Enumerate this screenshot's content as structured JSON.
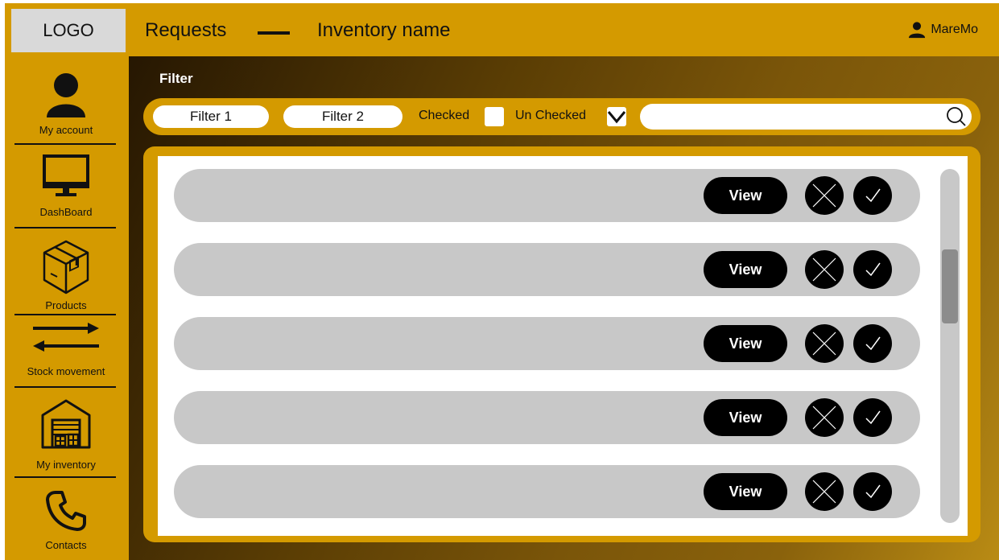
{
  "header": {
    "logo": "LOGO",
    "title": "Requests",
    "inventory_name": "Inventory name",
    "username": "MareMo"
  },
  "sidebar": {
    "items": [
      {
        "label": "My account",
        "icon": "user-icon"
      },
      {
        "label": "DashBoard",
        "icon": "monitor-icon"
      },
      {
        "label": "Products",
        "icon": "box-icon"
      },
      {
        "label": "Stock movement",
        "icon": "arrows-icon"
      },
      {
        "label": "My inventory",
        "icon": "warehouse-icon"
      },
      {
        "label": "Contacts",
        "icon": "phone-icon"
      }
    ]
  },
  "filter": {
    "title": "Filter",
    "filter1": "Filter 1",
    "filter2": "Filter 2",
    "checked_label": "Checked",
    "unchecked_label": "Un Checked",
    "checked_state": false,
    "unchecked_state": true,
    "search_placeholder": ""
  },
  "requests": {
    "rows": [
      {
        "view_label": "View"
      },
      {
        "view_label": "View"
      },
      {
        "view_label": "View"
      },
      {
        "view_label": "View"
      },
      {
        "view_label": "View"
      }
    ]
  },
  "colors": {
    "accent": "#d49a00",
    "row": "#c8c8c8",
    "button": "#000000"
  }
}
